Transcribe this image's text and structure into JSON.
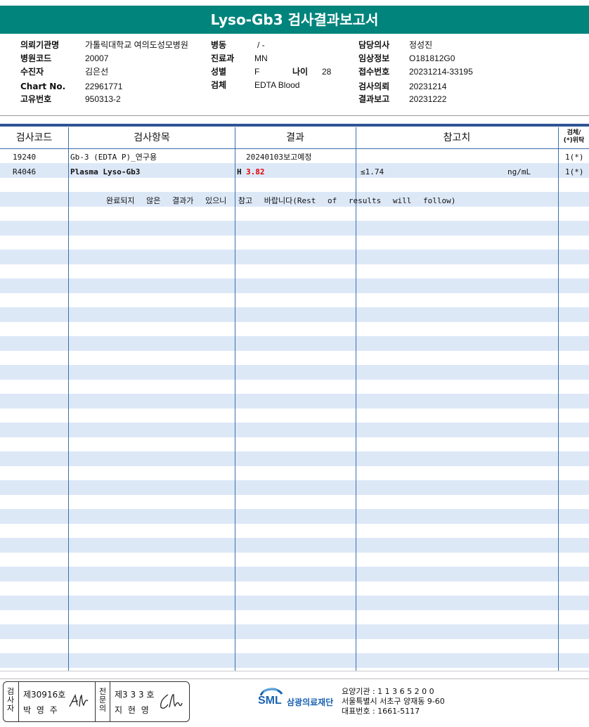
{
  "report": {
    "title": "Lyso-Gb3 검사결과보고서"
  },
  "header": {
    "col1": [
      {
        "label": "의뢰기관명",
        "value": "가톨릭대학교 여의도성모병원"
      },
      {
        "label": "병원코드",
        "value": "20007"
      },
      {
        "label": "수진자",
        "value": "김은선"
      },
      {
        "label": "Chart No.",
        "value": "22961771"
      },
      {
        "label": "고유번호",
        "value": "950313-2"
      }
    ],
    "col2": [
      {
        "label": "병동",
        "value": "/ -"
      },
      {
        "label": "진료과",
        "value": "MN"
      },
      {
        "label": "성별",
        "value": "F"
      },
      {
        "label": "검체",
        "value": "EDTA Blood"
      }
    ],
    "age": {
      "label": "나이",
      "value": "28"
    },
    "col3": [
      {
        "label": "담당의사",
        "value": "정성진"
      },
      {
        "label": "임상정보",
        "value": "O181812G0"
      },
      {
        "label": "접수번호",
        "value": "20231214-33195"
      },
      {
        "label": "검사의뢰",
        "value": "20231214"
      },
      {
        "label": "결과보고",
        "value": "20231222"
      }
    ]
  },
  "table": {
    "headers": [
      "검사코드",
      "검사항목",
      "결과",
      "참고치"
    ],
    "last_header_line1": "검체/",
    "last_header_line2": "(*)위탁",
    "rows": [
      {
        "code": "19240",
        "item": "Gb-3 (EDTA P)_연구용",
        "flag": "",
        "result": "20240103보고예정",
        "ref": "",
        "unit": "",
        "specimen": "1(*)"
      },
      {
        "code": "R4046",
        "item": "Plasma Lyso-Gb3",
        "flag": "H",
        "result": "3.82",
        "ref": "≤1.74",
        "unit": "ng/mL",
        "specimen": "1(*)"
      }
    ],
    "note": "완료되지 않은 결과가 있으니 참고 바랍니다(Rest of results will follow)"
  },
  "footer": {
    "box1_label": "검사자",
    "box1_line1": "제30916호",
    "box1_line2": "박 영 주",
    "box2_label": "전문의",
    "box2_line1": "제3 3 3 호",
    "box2_line2": "지 현 영",
    "sml_logo_text": "SML",
    "org_name": "삼광의료재단",
    "info_line1": "요양기관 : 1 1 3 6 5 2 0 0",
    "info_line2": "서울특별시 서초구 양재동 9-60",
    "info_line3": "대표번호 : 1661-5117"
  }
}
